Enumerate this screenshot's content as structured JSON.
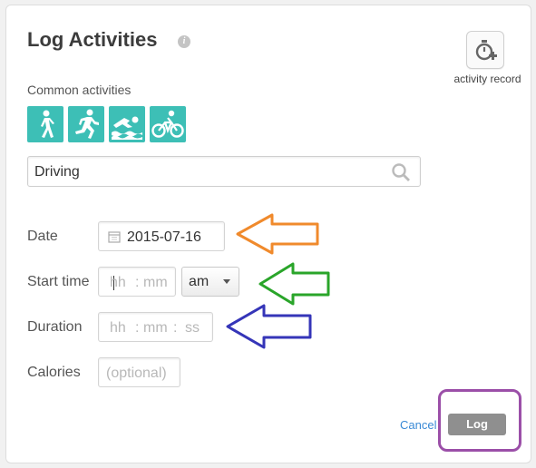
{
  "header": {
    "title": "Log Activities",
    "info_icon": "info-icon",
    "record_button": {
      "icon": "stopwatch-plus-icon",
      "label": "activity record"
    }
  },
  "common_activities": {
    "label": "Common activities",
    "items": [
      {
        "icon": "walking-icon"
      },
      {
        "icon": "running-icon"
      },
      {
        "icon": "swimming-icon"
      },
      {
        "icon": "cycling-icon"
      }
    ],
    "accent_color": "#3dbfb6"
  },
  "search": {
    "value": "Driving",
    "icon": "search-icon"
  },
  "form": {
    "date": {
      "label": "Date",
      "value": "2015-07-16",
      "icon": "calendar-icon"
    },
    "start_time": {
      "label": "Start time",
      "hour_placeholder": "hh",
      "separator": ":",
      "minute_placeholder": "mm",
      "ampm_value": "am"
    },
    "duration": {
      "label": "Duration",
      "hour_placeholder": "hh",
      "minute_placeholder": "mm",
      "second_placeholder": "ss",
      "separator": ":"
    },
    "calories": {
      "label": "Calories",
      "placeholder": "(optional)"
    }
  },
  "actions": {
    "cancel_label": "Cancel",
    "log_label": "Log"
  },
  "annotations": {
    "arrow_colors": [
      "#f08a2c",
      "#2aa52a",
      "#3535b8"
    ],
    "highlight_color": "#9b4fa8"
  }
}
